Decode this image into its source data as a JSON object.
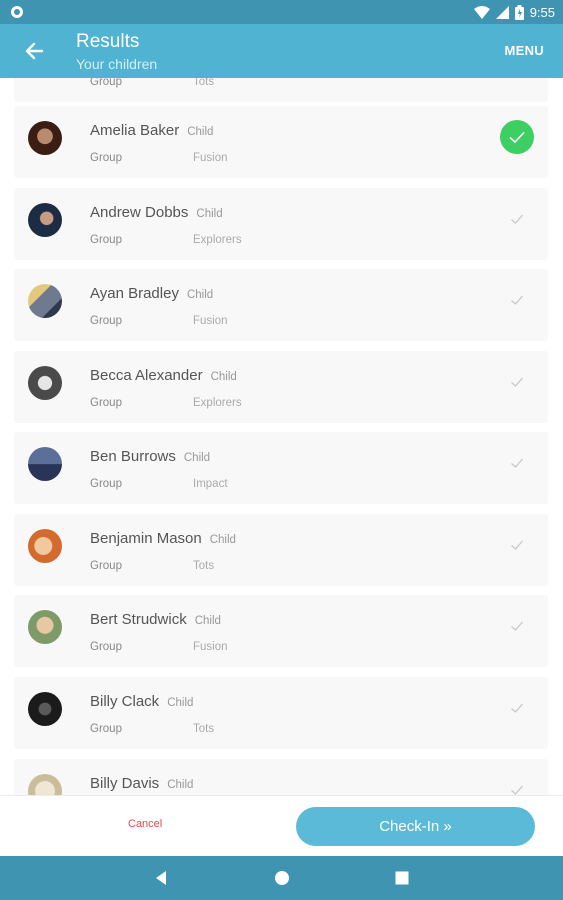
{
  "status_bar": {
    "time": "9:55",
    "icons": [
      "settings-circle-icon",
      "wifi-icon",
      "signal-icon",
      "battery-icon"
    ]
  },
  "app_bar": {
    "title": "Results",
    "subtitle": "Your children",
    "menu_label": "MENU",
    "back_icon": "arrow-left-icon"
  },
  "colors": {
    "accent": "#4fb3d1",
    "status_bar": "#3f94b2",
    "check_on": "#3ecf63",
    "cancel": "#e0484f"
  },
  "list": {
    "top_partial": {
      "group_label": "Group",
      "group": "Tots"
    },
    "items": [
      {
        "name": "Amelia Baker",
        "tag": "Child",
        "group_label": "Group",
        "group": "Fusion",
        "checked": true
      },
      {
        "name": "Andrew Dobbs",
        "tag": "Child",
        "group_label": "Group",
        "group": "Explorers",
        "checked": false
      },
      {
        "name": "Ayan Bradley",
        "tag": "Child",
        "group_label": "Group",
        "group": "Fusion",
        "checked": false
      },
      {
        "name": "Becca Alexander",
        "tag": "Child",
        "group_label": "Group",
        "group": "Explorers",
        "checked": false
      },
      {
        "name": "Ben Burrows",
        "tag": "Child",
        "group_label": "Group",
        "group": "Impact",
        "checked": false
      },
      {
        "name": "Benjamin Mason",
        "tag": "Child",
        "group_label": "Group",
        "group": "Tots",
        "checked": false
      },
      {
        "name": "Bert Strudwick",
        "tag": "Child",
        "group_label": "Group",
        "group": "Fusion",
        "checked": false
      },
      {
        "name": "Billy Clack",
        "tag": "Child",
        "group_label": "Group",
        "group": "Tots",
        "checked": false
      },
      {
        "name": "Billy Davis",
        "tag": "Child",
        "checked": false
      }
    ]
  },
  "actions": {
    "cancel_label": "Cancel",
    "checkin_label": "Check-In »"
  },
  "nav_bar": {
    "icons": [
      "back-triangle-icon",
      "home-circle-icon",
      "recents-square-icon"
    ]
  }
}
